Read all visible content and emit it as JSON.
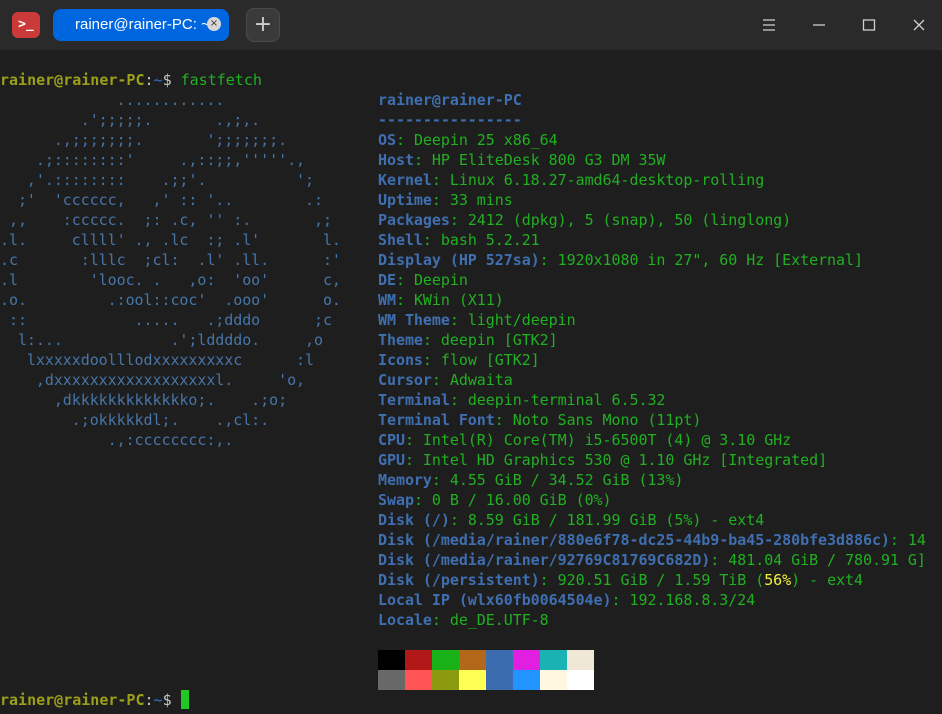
{
  "titlebar": {
    "app_icon_text": ">_",
    "tab_title": "rainer@rainer-PC: ~",
    "tab_close": "×",
    "new_tab": "+"
  },
  "prompt": {
    "user_host": "rainer@rainer-PC",
    "colon": ":",
    "dir": "~",
    "dollar": "$",
    "command": "fastfetch"
  },
  "logo": [
    "             ............",
    "         .';;;;;.       .,;,.",
    "      .,;;;;;;;.       ';;;;;;;.",
    "    .;::::::::'     .,::;;,'''''.,",
    "   ,'.::::::::    .;;'.          ';",
    "  ;'  'cccccc,   ,' :: '..        .:",
    " ,,    :ccccc.  ;: .c, '' :.       ,;",
    ".l.     cllll' ., .lc  :; .l'       l.",
    ".c       :lllc  ;cl:  .l' .ll.      :'",
    ".l        'looc. .   ,o:  'oo'      c,",
    ".o.         .:ool::coc'  .ooo'      o.",
    " ::            .....   .;dddo      ;c",
    "  l:...            .';lddddo.     ,o",
    "   lxxxxxdoolllodxxxxxxxxxc      :l",
    "    ,dxxxxxxxxxxxxxxxxxxl.     'o,",
    "      ,dkkkkkkkkkkkkko;.    .;o;",
    "        .;okkkkkdl;.    .,cl:.",
    "            .,:cccccccc:,."
  ],
  "header": {
    "user_host": "rainer@rainer-PC",
    "separator": "----------------"
  },
  "info": [
    {
      "key": "OS",
      "value": "Deepin 25 x86_64"
    },
    {
      "key": "Host",
      "value": "HP EliteDesk 800 G3 DM 35W"
    },
    {
      "key": "Kernel",
      "value": "Linux 6.18.27-amd64-desktop-rolling"
    },
    {
      "key": "Uptime",
      "value": "33 mins"
    },
    {
      "key": "Packages",
      "value": "2412 (dpkg), 5 (snap), 50 (linglong)"
    },
    {
      "key": "Shell",
      "value": "bash 5.2.21"
    },
    {
      "key": "Display (HP 527sa)",
      "value": "1920x1080 in 27\", 60 Hz [External]"
    },
    {
      "key": "DE",
      "value": "Deepin"
    },
    {
      "key": "WM",
      "value": "KWin (X11)"
    },
    {
      "key": "WM Theme",
      "value": "light/deepin"
    },
    {
      "key": "Theme",
      "value": "deepin [GTK2]"
    },
    {
      "key": "Icons",
      "value": "flow [GTK2]"
    },
    {
      "key": "Cursor",
      "value": "Adwaita"
    },
    {
      "key": "Terminal",
      "value": "deepin-terminal 6.5.32"
    },
    {
      "key": "Terminal Font",
      "value": "Noto Sans Mono (11pt)"
    },
    {
      "key": "CPU",
      "value": "Intel(R) Core(TM) i5-6500T (4) @ 3.10 GHz"
    },
    {
      "key": "GPU",
      "value": "Intel HD Graphics 530 @ 1.10 GHz [Integrated]"
    },
    {
      "key": "Memory",
      "value": "4.55 GiB / 34.52 GiB (13%)"
    },
    {
      "key": "Swap",
      "value": "0 B / 16.00 GiB (0%)"
    },
    {
      "key": "Disk (/)",
      "value": "8.59 GiB / 181.99 GiB (5%) - ext4"
    },
    {
      "key": "Disk (/media/rainer/880e6f78-dc25-44b9-ba45-280bfe3d886c)",
      "value": "14"
    },
    {
      "key": "Disk (/media/rainer/92769C81769C682D)",
      "value": "481.04 GiB / 780.91 G]"
    },
    {
      "key": "Disk (/persistent)",
      "value_pre": "920.51 GiB / 1.59 TiB (",
      "value_hl": "56%",
      "value_post": ") - ext4"
    },
    {
      "key": "Local IP (wlx60fb0064504e)",
      "value": "192.168.8.3/24"
    },
    {
      "key": "Locale",
      "value": "de_DE.UTF-8"
    }
  ],
  "colors": {
    "row1": [
      "#000000",
      "#b21818",
      "#18b218",
      "#b26818",
      "#3b6cb0",
      "#e01fe0",
      "#1ab2b2",
      "#f0e8d6"
    ],
    "row2": [
      "#686868",
      "#ff5454",
      "#8c9a10",
      "#ffff54",
      "#3b6cb0",
      "#2194ff",
      "#fff7e0",
      "#ffffff"
    ]
  }
}
